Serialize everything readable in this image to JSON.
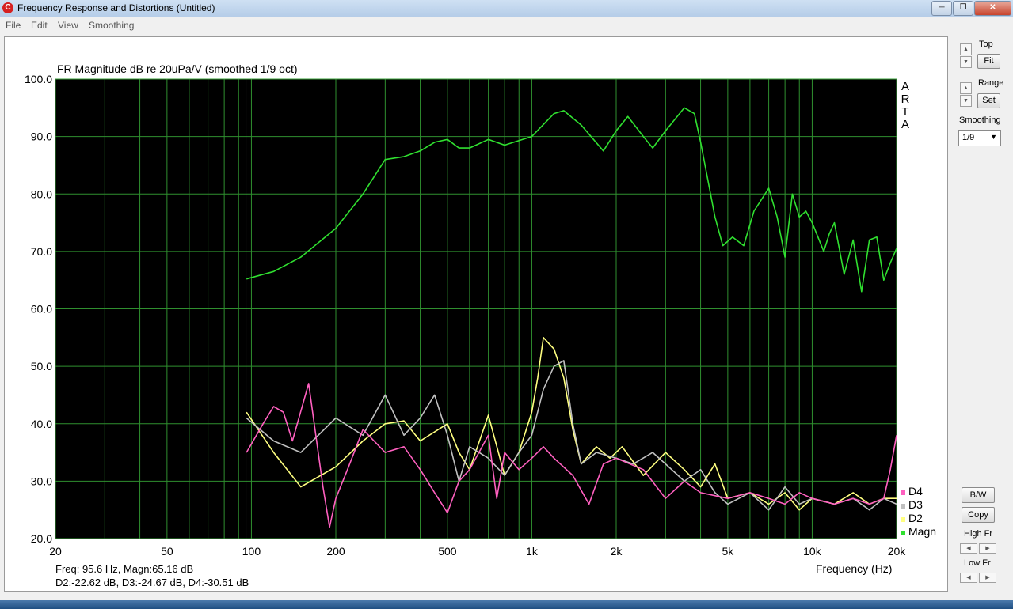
{
  "window": {
    "title": "Frequency Response and Distortions (Untitled)",
    "app_icon": "C"
  },
  "menu": [
    "File",
    "Edit",
    "View",
    "Smoothing"
  ],
  "chart": {
    "title": "FR Magnitude dB re 20uPa/V (smoothed 1/9 oct)",
    "watermark": [
      "A",
      "R",
      "T",
      "A"
    ],
    "xlabel": "Frequency (Hz)",
    "readout1": "Freq: 95.6 Hz, Magn:65.16 dB",
    "readout2": "D2:-22.62 dB, D3:-24.67 dB, D4:-30.51 dB"
  },
  "chart_data": {
    "type": "line",
    "title": "FR Magnitude dB re 20uPa/V (smoothed 1/9 oct)",
    "xlabel": "Frequency (Hz)",
    "x_scale": "log",
    "xlim": [
      20,
      20000
    ],
    "ylim": [
      20,
      100
    ],
    "x_ticks": [
      {
        "v": 20,
        "l": "20"
      },
      {
        "v": 50,
        "l": "50"
      },
      {
        "v": 100,
        "l": "100"
      },
      {
        "v": 200,
        "l": "200"
      },
      {
        "v": 500,
        "l": "500"
      },
      {
        "v": 1000,
        "l": "1k"
      },
      {
        "v": 2000,
        "l": "2k"
      },
      {
        "v": 5000,
        "l": "5k"
      },
      {
        "v": 10000,
        "l": "10k"
      },
      {
        "v": 20000,
        "l": "20k"
      }
    ],
    "y_ticks": [
      {
        "v": 100,
        "l": "100.0"
      },
      {
        "v": 90,
        "l": "90.0"
      },
      {
        "v": 80,
        "l": "80.0"
      },
      {
        "v": 70,
        "l": "70.0"
      },
      {
        "v": 60,
        "l": "60.0"
      },
      {
        "v": 50,
        "l": "50.0"
      },
      {
        "v": 40,
        "l": "40.0"
      },
      {
        "v": 30,
        "l": "30.0"
      },
      {
        "v": 20,
        "l": "20.0"
      }
    ],
    "cursor_hz": 95.6,
    "grid": true,
    "legend_position": "bottom-right",
    "series": [
      {
        "name": "Magn",
        "color": "#30e030",
        "x": [
          96,
          120,
          150,
          200,
          250,
          300,
          350,
          400,
          450,
          500,
          550,
          600,
          700,
          800,
          1000,
          1200,
          1300,
          1500,
          1800,
          2000,
          2200,
          2500,
          2700,
          3000,
          3500,
          3800,
          4000,
          4500,
          4800,
          5200,
          5700,
          6200,
          7000,
          7500,
          8000,
          8500,
          9000,
          9500,
          10000,
          11000,
          11500,
          12000,
          13000,
          14000,
          15000,
          16000,
          17000,
          18000,
          19000,
          20000
        ],
        "y": [
          65.2,
          66.5,
          69,
          74,
          80,
          86,
          86.5,
          87.5,
          89,
          89.5,
          88,
          88,
          89.5,
          88.5,
          90,
          94,
          94.5,
          92,
          87.5,
          91,
          93.5,
          90,
          88,
          91,
          95,
          94,
          89,
          76,
          71,
          72.5,
          71,
          77,
          81,
          76,
          69,
          80,
          76,
          77,
          75,
          70,
          73,
          75,
          66,
          72,
          63,
          72,
          72.5,
          65,
          68,
          70.5
        ]
      },
      {
        "name": "D2",
        "color": "#ffff80",
        "x": [
          96,
          120,
          150,
          200,
          250,
          300,
          350,
          400,
          500,
          550,
          600,
          700,
          800,
          900,
          1000,
          1050,
          1100,
          1200,
          1300,
          1400,
          1500,
          1700,
          1900,
          2100,
          2500,
          3000,
          3500,
          4000,
          4500,
          5000,
          6000,
          7000,
          8000,
          9000,
          10000,
          12000,
          14000,
          16000,
          18000,
          20000
        ],
        "y": [
          42,
          35,
          29,
          32.5,
          37,
          40,
          40.5,
          37,
          40,
          35,
          32,
          41.5,
          31,
          35,
          42,
          48,
          55,
          53,
          48,
          39,
          33,
          36,
          34,
          36,
          31,
          35,
          32,
          29,
          33,
          27,
          28,
          26,
          28,
          25,
          27,
          26,
          28,
          26,
          27,
          27
        ]
      },
      {
        "name": "D3",
        "color": "#c0c0c0",
        "x": [
          96,
          120,
          150,
          200,
          250,
          300,
          350,
          400,
          450,
          500,
          550,
          600,
          700,
          800,
          900,
          1000,
          1100,
          1200,
          1300,
          1400,
          1500,
          1700,
          2000,
          2300,
          2700,
          3000,
          3500,
          4000,
          4500,
          5000,
          6000,
          7000,
          8000,
          9000,
          10000,
          12000,
          14000,
          16000,
          18000,
          20000
        ],
        "y": [
          41,
          37,
          35,
          41,
          38,
          45,
          38,
          41,
          45,
          38,
          30,
          36,
          34,
          31,
          35,
          38,
          46,
          50,
          51,
          40,
          33,
          35,
          34,
          33,
          35,
          33,
          30,
          32,
          28,
          26,
          28,
          25,
          29,
          26,
          27,
          26,
          27,
          25,
          27,
          26
        ]
      },
      {
        "name": "D4",
        "color": "#ff60c0",
        "x": [
          96,
          110,
          120,
          130,
          140,
          160,
          180,
          190,
          200,
          220,
          250,
          300,
          350,
          400,
          450,
          500,
          550,
          600,
          700,
          750,
          800,
          900,
          1000,
          1100,
          1200,
          1400,
          1600,
          1800,
          2000,
          2500,
          3000,
          3500,
          4000,
          5000,
          6000,
          7000,
          8000,
          9000,
          10000,
          12000,
          14000,
          16000,
          18000,
          19000,
          20000
        ],
        "y": [
          35,
          40,
          43,
          42,
          37,
          47,
          29,
          22,
          27,
          32,
          39,
          35,
          36,
          32,
          28,
          24.5,
          30,
          32,
          38,
          27,
          35,
          32,
          34,
          36,
          34,
          31,
          26,
          33,
          34,
          32,
          27,
          30,
          28,
          27,
          28,
          27,
          26,
          28,
          27,
          26,
          27,
          26,
          27,
          32,
          38
        ]
      }
    ]
  },
  "sidebar": {
    "top_label": "Top",
    "fit_label": "Fit",
    "range_label": "Range",
    "set_label": "Set",
    "smoothing_label": "Smoothing",
    "smoothing_value": "1/9",
    "bw_label": "B/W",
    "copy_label": "Copy",
    "high_label": "High Fr",
    "low_label": "Low Fr"
  }
}
